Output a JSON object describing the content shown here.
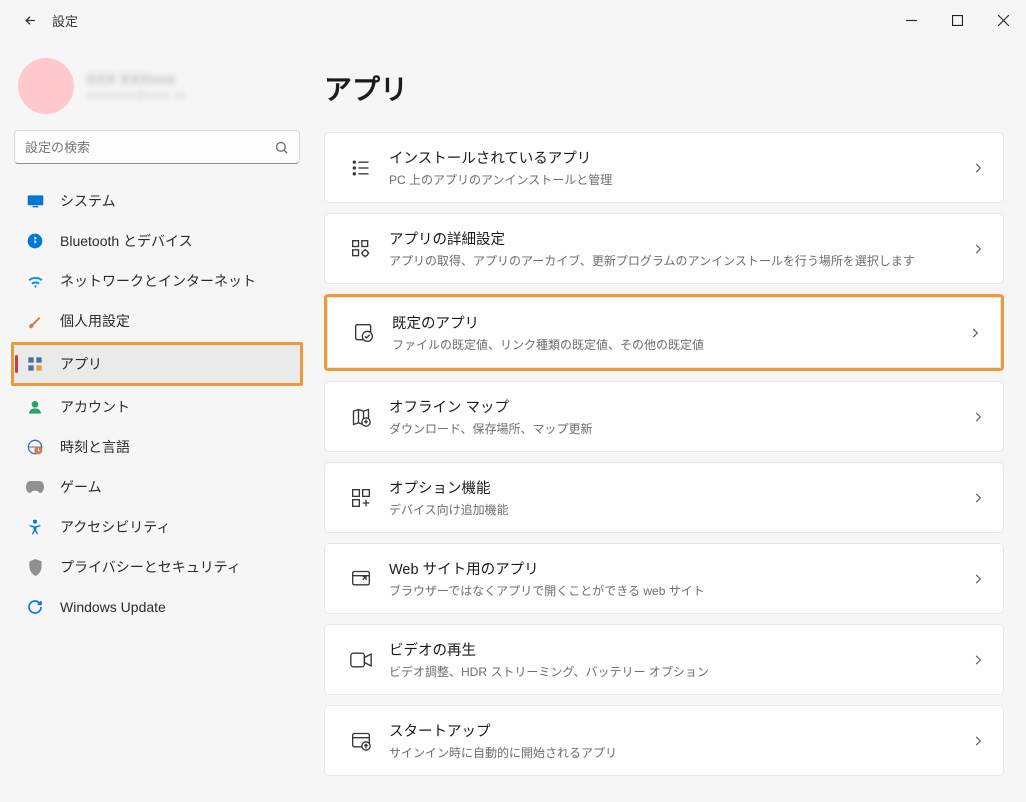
{
  "window": {
    "title": "設定"
  },
  "account": {
    "name": "XXX XXXxxx",
    "email": "xxxxxxxx@xxxx.xx"
  },
  "search": {
    "placeholder": "設定の検索"
  },
  "sidebar": {
    "items": [
      {
        "label": "システム"
      },
      {
        "label": "Bluetooth とデバイス"
      },
      {
        "label": "ネットワークとインターネット"
      },
      {
        "label": "個人用設定"
      },
      {
        "label": "アプリ"
      },
      {
        "label": "アカウント"
      },
      {
        "label": "時刻と言語"
      },
      {
        "label": "ゲーム"
      },
      {
        "label": "アクセシビリティ"
      },
      {
        "label": "プライバシーとセキュリティ"
      },
      {
        "label": "Windows Update"
      }
    ]
  },
  "page": {
    "title": "アプリ",
    "cards": [
      {
        "title": "インストールされているアプリ",
        "sub": "PC 上のアプリのアンインストールと管理"
      },
      {
        "title": "アプリの詳細設定",
        "sub": "アプリの取得、アプリのアーカイブ、更新プログラムのアンインストールを行う場所を選択します"
      },
      {
        "title": "既定のアプリ",
        "sub": "ファイルの既定値、リンク種類の既定値、その他の既定値"
      },
      {
        "title": "オフライン マップ",
        "sub": "ダウンロード、保存場所、マップ更新"
      },
      {
        "title": "オプション機能",
        "sub": "デバイス向け追加機能"
      },
      {
        "title": "Web サイト用のアプリ",
        "sub": "ブラウザーではなくアプリで開くことができる web サイト"
      },
      {
        "title": "ビデオの再生",
        "sub": "ビデオ調整、HDR ストリーミング、バッテリー オプション"
      },
      {
        "title": "スタートアップ",
        "sub": "サインイン時に自動的に開始されるアプリ"
      }
    ]
  }
}
